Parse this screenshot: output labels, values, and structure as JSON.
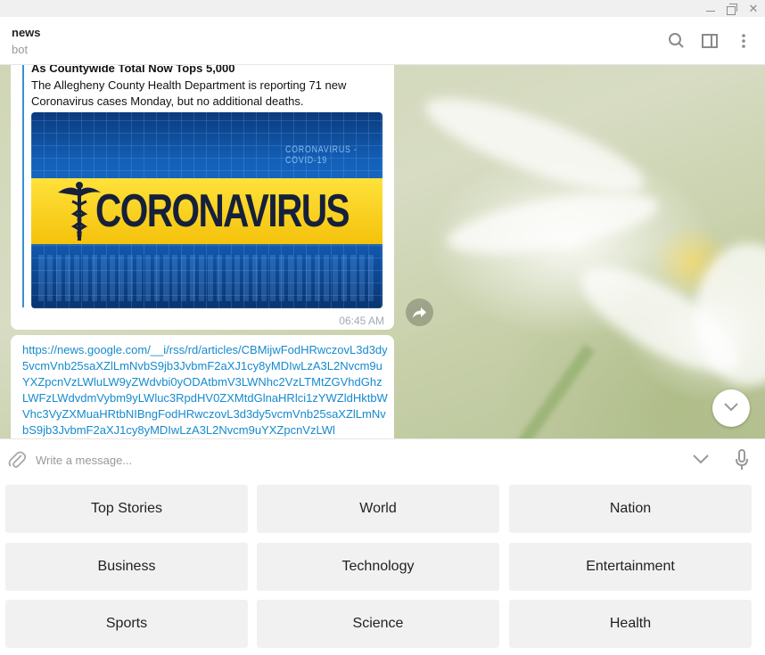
{
  "header": {
    "title": "news",
    "subtitle": "bot"
  },
  "messages": [
    {
      "article_title": "As Countywide Total Now Tops 5,000",
      "article_description": "The Allegheny County Health Department is reporting 71 new Coronavirus cases Monday, but no additional deaths.",
      "image_text": "CORONAVIRUS",
      "image_small_text": "CORONAVIRUS - COVID-19",
      "time": "06:45 AM"
    },
    {
      "link": "https://news.google.com/__i/rss/rd/articles/CBMijwFodHRwczovL3d3dy5vcmVnb25saXZlLmNvbS9jb3JvbmF2aXJ1cy8yMDIwLzA3L2Nvcm9uYXZpcnVzLWluLW9yZWdvbi0yODAtbmV3LWNhc2VzLTMtZGVhdGhzLWFzLWdvdmVybm9yLWluc3RpdHV0ZXMtdGlnaHRlci1zYWZldHktbWVhc3VyZXMuaHRtbNIBngFodHRwczovL3d3dy5vcmVnb25saXZlLmNvbS9jb3JvbmF2aXJ1cy8yMDIwLzA3L2Nvcm9uYXZpcnVzLWl"
    }
  ],
  "composer": {
    "placeholder": "Write a message..."
  },
  "keyboard": {
    "rows": [
      [
        "Top Stories",
        "World",
        "Nation"
      ],
      [
        "Business",
        "Technology",
        "Entertainment"
      ],
      [
        "Sports",
        "Science",
        "Health"
      ]
    ]
  },
  "colors": {
    "link": "#168acd",
    "quote_bar": "#3a8fd3",
    "button_bg": "#f1f1f1"
  },
  "icons": [
    "minimize-icon",
    "maximize-icon",
    "close-icon",
    "search-icon",
    "side-panel-icon",
    "more-vertical-icon",
    "share-icon",
    "chevron-down-icon",
    "paperclip-icon",
    "microphone-icon"
  ]
}
